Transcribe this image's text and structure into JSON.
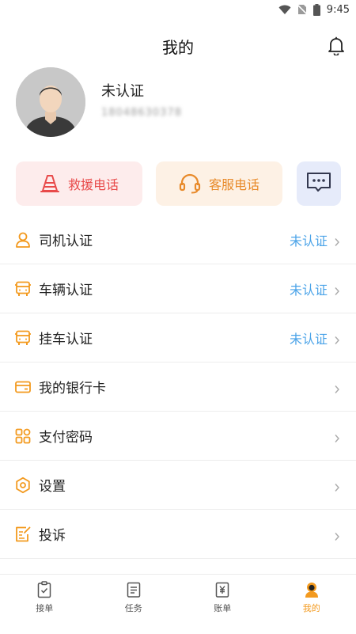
{
  "status_bar": {
    "time": "9:45"
  },
  "header": {
    "title": "我的"
  },
  "profile": {
    "name": "未认证",
    "phone": "18048630378"
  },
  "quick_actions": {
    "rescue_label": "救援电话",
    "service_label": "客服电话"
  },
  "menu": [
    {
      "label": "司机认证",
      "status": "未认证",
      "icon": "driver-icon"
    },
    {
      "label": "车辆认证",
      "status": "未认证",
      "icon": "truck-icon"
    },
    {
      "label": "挂车认证",
      "status": "未认证",
      "icon": "trailer-icon"
    },
    {
      "label": "我的银行卡",
      "status": "",
      "icon": "bank-card-icon"
    },
    {
      "label": "支付密码",
      "status": "",
      "icon": "grid-icon"
    },
    {
      "label": "设置",
      "status": "",
      "icon": "gear-icon"
    },
    {
      "label": "投诉",
      "status": "",
      "icon": "complaint-icon"
    }
  ],
  "tabs": [
    {
      "label": "接单",
      "active": false
    },
    {
      "label": "任务",
      "active": false
    },
    {
      "label": "账单",
      "active": false
    },
    {
      "label": "我的",
      "active": true
    }
  ],
  "colors": {
    "accent": "#f39a1f",
    "status_blue": "#4aa3e8",
    "rescue_red": "#e84a4a",
    "service_orange": "#e88a2a"
  }
}
